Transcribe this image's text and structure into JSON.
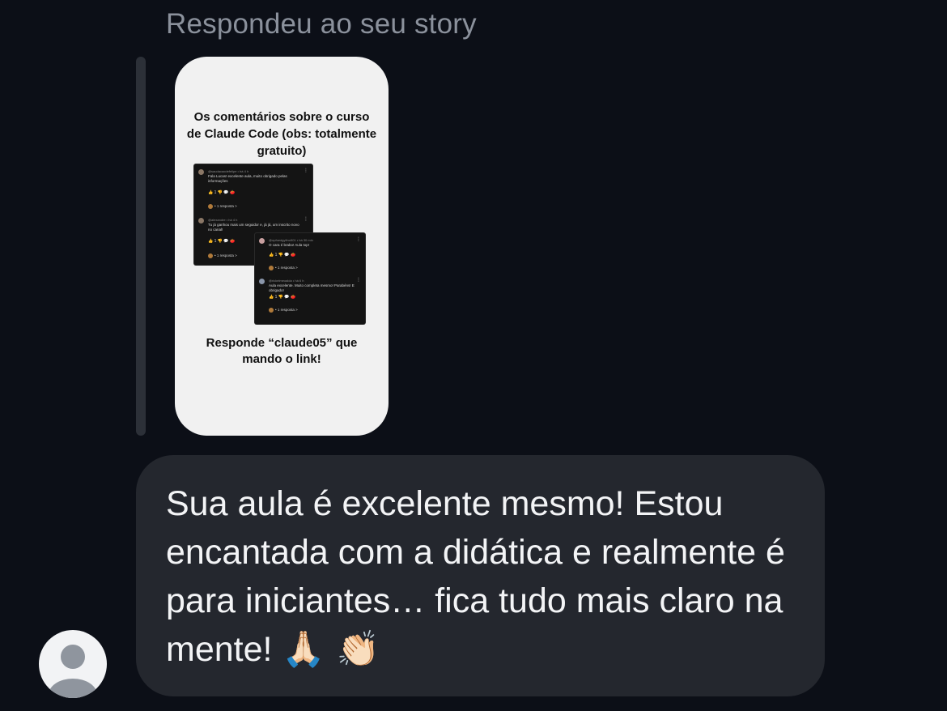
{
  "header": {
    "reply_label": "Respondeu ao seu story"
  },
  "story": {
    "title": "Os comentários sobre o curso de Claude Code (obs: totalmente gratuito)",
    "cta": "Responde “claude05” que mando o link!",
    "comments": [
      {
        "user": "@saudacaodefelipe • há 4 h",
        "text": "Fala Lucas! excelente aula, muito obrigado pelas informações",
        "actions": "👍 1   👎   💬   🍅",
        "replies": "• 1 resposta >"
      },
      {
        "user": "@alexandre • há 4 h",
        "text": "Tu já ganhou mais um seguidor e, já já, um inscrito novo no canal!",
        "actions": "👍 1   👎   💬   🍅",
        "replies": "• 1 resposta >"
      },
      {
        "user": "@opfoedgyfino901 • há 30 min",
        "text": "O cara é brabo! Aula top!",
        "actions": "👍 1   👎   💬   🍅",
        "replies": "• 1 resposta >"
      },
      {
        "user": "@rickelmeoalda • há 6 h",
        "text": "Aula excelente. Muito completa mesmo! Parabéns! E obrigado!",
        "actions": "👍 1   👎   💬   🍅",
        "replies": "• 1 resposta >"
      }
    ]
  },
  "message": {
    "text": "Sua aula é excelente mesmo! Estou encantada com a didática e realmente é para iniciantes… fica tudo mais claro na mente!",
    "emojis": "🙏🏻 👏🏻"
  },
  "avatar": {
    "icon": "default-user-icon"
  }
}
